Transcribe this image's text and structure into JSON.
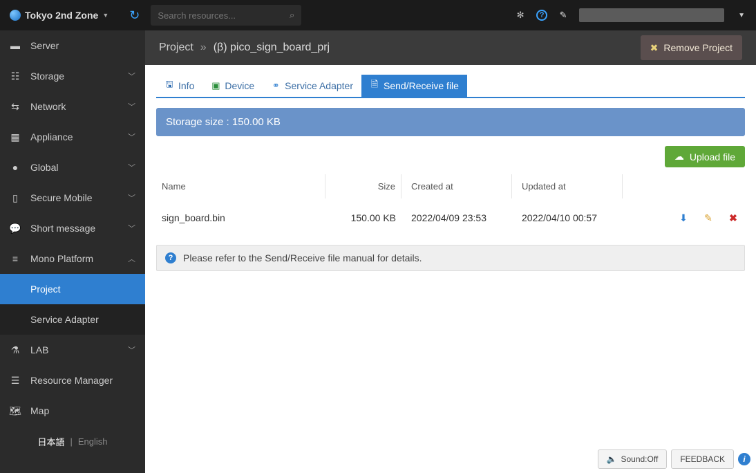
{
  "top": {
    "zone": "Tokyo 2nd Zone",
    "search_placeholder": "Search resources..."
  },
  "sidebar": {
    "items": [
      {
        "label": "Server",
        "icon": "server-icon",
        "expandable": false
      },
      {
        "label": "Storage",
        "icon": "storage-icon",
        "expandable": true
      },
      {
        "label": "Network",
        "icon": "network-icon",
        "expandable": true
      },
      {
        "label": "Appliance",
        "icon": "appliance-icon",
        "expandable": true
      },
      {
        "label": "Global",
        "icon": "global-icon",
        "expandable": true
      },
      {
        "label": "Secure Mobile",
        "icon": "secure-mobile-icon",
        "expandable": true
      },
      {
        "label": "Short message",
        "icon": "short-message-icon",
        "expandable": true
      },
      {
        "label": "Mono Platform",
        "icon": "mono-platform-icon",
        "expandable": true,
        "expanded": true,
        "children": [
          {
            "label": "Project",
            "active": true
          },
          {
            "label": "Service Adapter",
            "active": false
          }
        ]
      },
      {
        "label": "LAB",
        "icon": "lab-icon",
        "expandable": true
      },
      {
        "label": "Resource Manager",
        "icon": "resource-manager-icon",
        "expandable": false
      },
      {
        "label": "Map",
        "icon": "map-icon",
        "expandable": false
      }
    ],
    "lang_jp": "日本語",
    "lang_en": "English"
  },
  "breadcrumb": {
    "root": "Project",
    "current": "(β) pico_sign_board_prj",
    "remove_label": "Remove Project"
  },
  "tabs": [
    {
      "label": "Info",
      "icon": "info-tab-icon"
    },
    {
      "label": "Device",
      "icon": "device-tab-icon"
    },
    {
      "label": "Service Adapter",
      "icon": "service-adapter-tab-icon"
    },
    {
      "label": "Send/Receive file",
      "icon": "file-tab-icon",
      "active": true
    }
  ],
  "storage_banner": "Storage size : 150.00 KB",
  "upload_label": "Upload file",
  "table": {
    "headers": {
      "name": "Name",
      "size": "Size",
      "created": "Created at",
      "updated": "Updated at"
    },
    "rows": [
      {
        "name": "sign_board.bin",
        "size": "150.00 KB",
        "created": "2022/04/09 23:53",
        "updated": "2022/04/10 00:57"
      }
    ]
  },
  "info_text": "Please refer to the Send/Receive file manual for details.",
  "bottom": {
    "sound": "Sound:Off",
    "feedback": "FEEDBACK"
  },
  "icon_glyphs": {
    "server-icon": "▬",
    "storage-icon": "☷",
    "network-icon": "⇆",
    "appliance-icon": "▦",
    "global-icon": "●",
    "secure-mobile-icon": "▯",
    "short-message-icon": "💬",
    "mono-platform-icon": "≡",
    "lab-icon": "⚗",
    "resource-manager-icon": "☰",
    "map-icon": "🗺"
  }
}
